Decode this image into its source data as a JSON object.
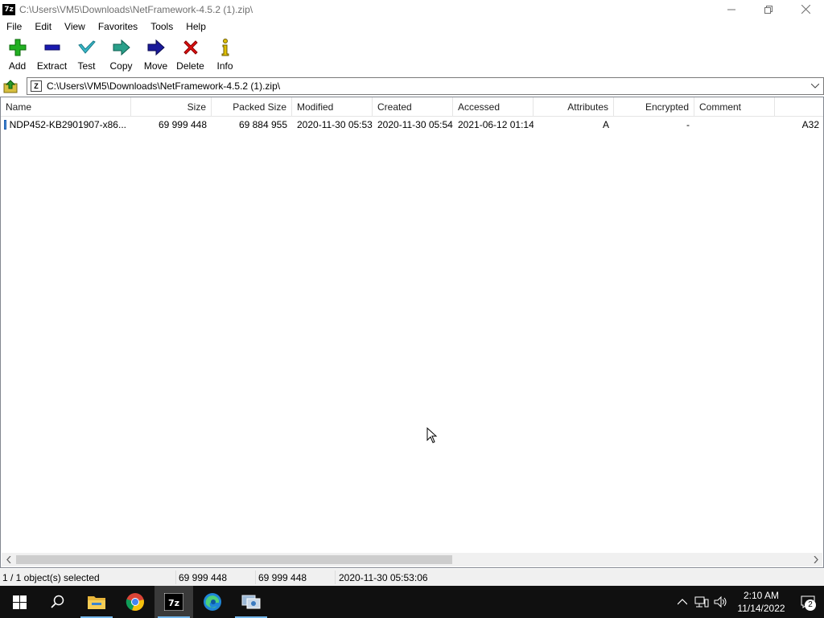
{
  "window": {
    "title": "C:\\Users\\VM5\\Downloads\\NetFramework-4.5.2 (1).zip\\",
    "app_icon_text": "7z"
  },
  "menu": [
    "File",
    "Edit",
    "View",
    "Favorites",
    "Tools",
    "Help"
  ],
  "toolbar": [
    {
      "label": "Add",
      "icon": "plus-icon",
      "color": "#1ca01c"
    },
    {
      "label": "Extract",
      "icon": "minus-icon",
      "color": "#1a1aa0"
    },
    {
      "label": "Test",
      "icon": "check-icon",
      "color": "#2aa3b0"
    },
    {
      "label": "Copy",
      "icon": "copy-arrow-icon",
      "color": "#2a9a8a"
    },
    {
      "label": "Move",
      "icon": "move-arrow-icon",
      "color": "#1a1a90"
    },
    {
      "label": "Delete",
      "icon": "delete-x-icon",
      "color": "#e01010"
    },
    {
      "label": "Info",
      "icon": "info-icon",
      "color": "#a08000"
    }
  ],
  "address": {
    "path": "C:\\Users\\VM5\\Downloads\\NetFramework-4.5.2 (1).zip\\"
  },
  "columns": [
    "Name",
    "Size",
    "Packed Size",
    "Modified",
    "Created",
    "Accessed",
    "Attributes",
    "Encrypted",
    "Comment"
  ],
  "rows": [
    {
      "name": "NDP452-KB2901907-x86...",
      "size": "69 999 448",
      "packed_size": "69 884 955",
      "modified": "2020-11-30 05:53",
      "created": "2020-11-30 05:54",
      "accessed": "2021-06-12 01:14",
      "attributes": "A",
      "encrypted": "-",
      "comment": "",
      "overflow": "A32"
    }
  ],
  "status": {
    "selection": "1 / 1 object(s) selected",
    "size": "69 999 448",
    "packed": "69 999 448",
    "date": "2020-11-30 05:53:06"
  },
  "taskbar": {
    "apps": [
      "windows-start-icon",
      "search-icon",
      "file-explorer-icon",
      "chrome-icon",
      "7zip-icon",
      "edge-icon",
      "network-app-icon"
    ],
    "time": "2:10 AM",
    "date": "11/14/2022",
    "notifications": "2"
  }
}
